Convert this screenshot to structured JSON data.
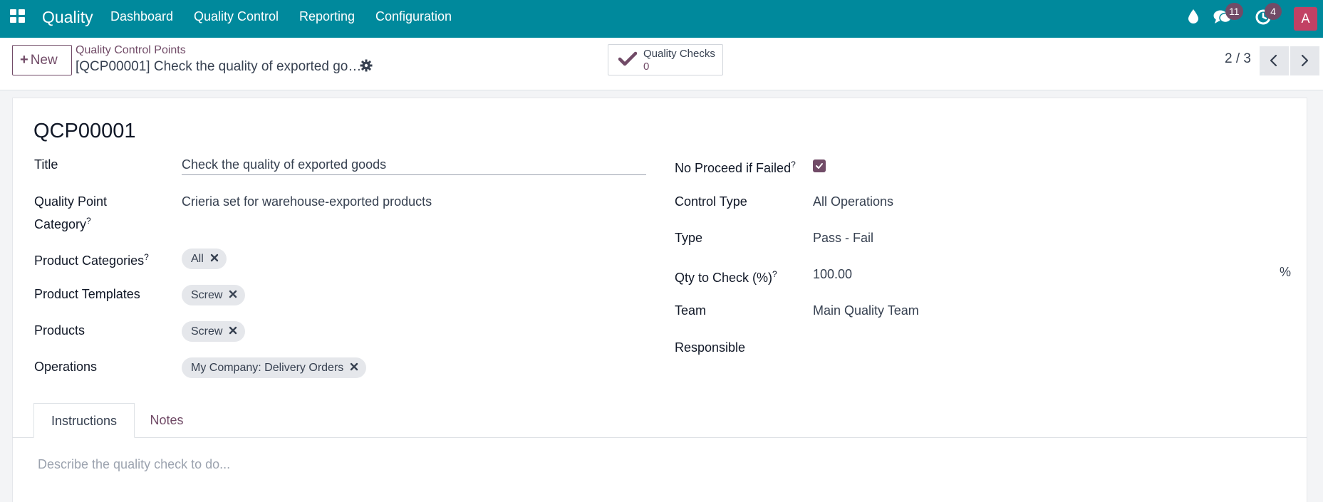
{
  "navbar": {
    "app_name": "Quality",
    "menu": [
      "Dashboard",
      "Quality Control",
      "Reporting",
      "Configuration"
    ],
    "messages_count": "11",
    "activities_count": "4",
    "avatar_initial": "A",
    "icons": [
      "apps-grid-icon",
      "drop-icon",
      "chat-icon",
      "clock-icon"
    ]
  },
  "control_panel": {
    "new_label": "New",
    "breadcrumb": "Quality Control Points",
    "record_name": "[QCP00001] Check the quality of exported go…",
    "smart_button": {
      "label": "Quality Checks",
      "count": "0"
    },
    "pager": "2 / 3"
  },
  "form": {
    "reference": "QCP00001",
    "left": {
      "title_label": "Title",
      "title_value": "Check the quality of exported goods",
      "category_label_line1": "Quality Point",
      "category_label_line2": "Category",
      "category_value": "Crieria set for warehouse-exported products",
      "product_categories_label": "Product Categories",
      "product_categories_tags": [
        "All"
      ],
      "product_templates_label": "Product Templates",
      "product_templates_tags": [
        "Screw"
      ],
      "products_label": "Products",
      "products_tags": [
        "Screw"
      ],
      "operations_label": "Operations",
      "operations_tags": [
        "My Company: Delivery Orders"
      ]
    },
    "right": {
      "no_proceed_label": "No Proceed if Failed",
      "no_proceed_checked": true,
      "control_type_label": "Control Type",
      "control_type_value": "All Operations",
      "type_label": "Type",
      "type_value": "Pass - Fail",
      "qty_label": "Qty to Check (%)",
      "qty_value": "100.00",
      "qty_unit": "%",
      "team_label": "Team",
      "team_value": "Main Quality Team",
      "responsible_label": "Responsible",
      "responsible_value": ""
    },
    "help_marker": "?",
    "tabs": [
      "Instructions",
      "Notes"
    ],
    "instructions_placeholder": "Describe the quality check to do..."
  },
  "colors": {
    "navbar": "#00899c",
    "accent": "#714b67",
    "avatar": "#c24164"
  }
}
